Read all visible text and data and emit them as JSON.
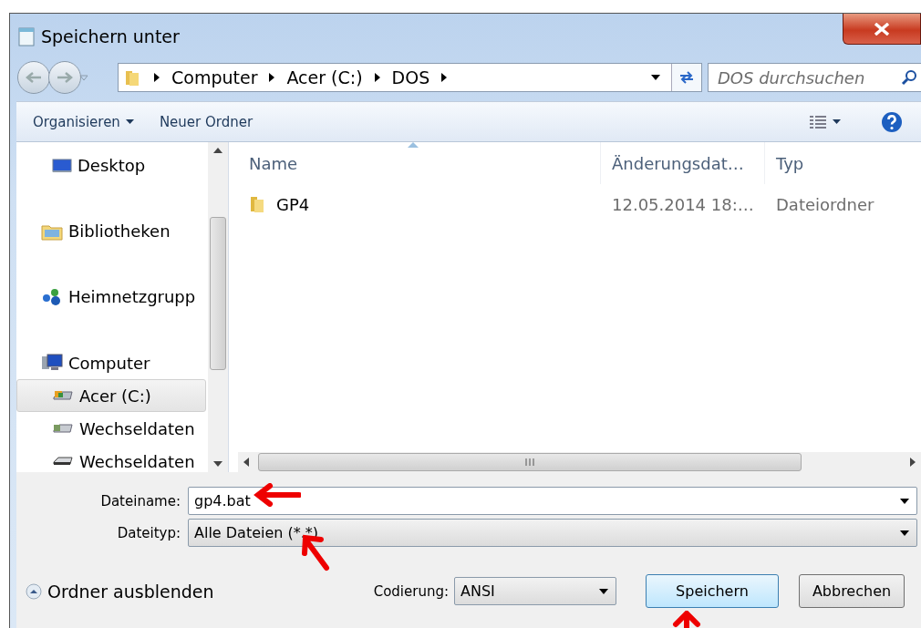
{
  "window": {
    "title": "Speichern unter"
  },
  "breadcrumb": [
    "Computer",
    "Acer (C:)",
    "DOS"
  ],
  "search": {
    "placeholder": "DOS durchsuchen"
  },
  "toolbar": {
    "organize": "Organisieren",
    "new_folder": "Neuer Ordner"
  },
  "sidebar": {
    "groups": [
      {
        "children": [
          {
            "label": "Desktop",
            "kind": "desktop",
            "selected": false
          }
        ]
      },
      {
        "label": "Bibliotheken",
        "kind": "library",
        "selected": false
      },
      {
        "label": "Heimnetzgrupp",
        "kind": "homegroup",
        "selected": false
      },
      {
        "label": "Computer",
        "kind": "computer",
        "selected": false,
        "children": [
          {
            "label": "Acer (C:)",
            "kind": "drive",
            "selected": true
          },
          {
            "label": "Wechseldaten",
            "kind": "removable",
            "selected": false
          },
          {
            "label": "Wechseldaten",
            "kind": "usb",
            "selected": false
          }
        ]
      }
    ]
  },
  "columns": [
    {
      "label": "Name",
      "sorted": true
    },
    {
      "label": "Änderungsdat…",
      "sorted": false
    },
    {
      "label": "Typ",
      "sorted": false
    }
  ],
  "rows": [
    {
      "name": "GP4",
      "modified": "12.05.2014 18:…",
      "type": "Dateiordner"
    }
  ],
  "filename": {
    "label": "Dateiname:",
    "value": "gp4.bat"
  },
  "filetype": {
    "label": "Dateityp:",
    "value": "Alle Dateien  (*.*)"
  },
  "hide_folders": "Ordner ausblenden",
  "encoding": {
    "label": "Codierung:",
    "value": "ANSI"
  },
  "buttons": [
    {
      "label": "Speichern",
      "default": true
    },
    {
      "label": "Abbrechen",
      "default": false
    }
  ]
}
